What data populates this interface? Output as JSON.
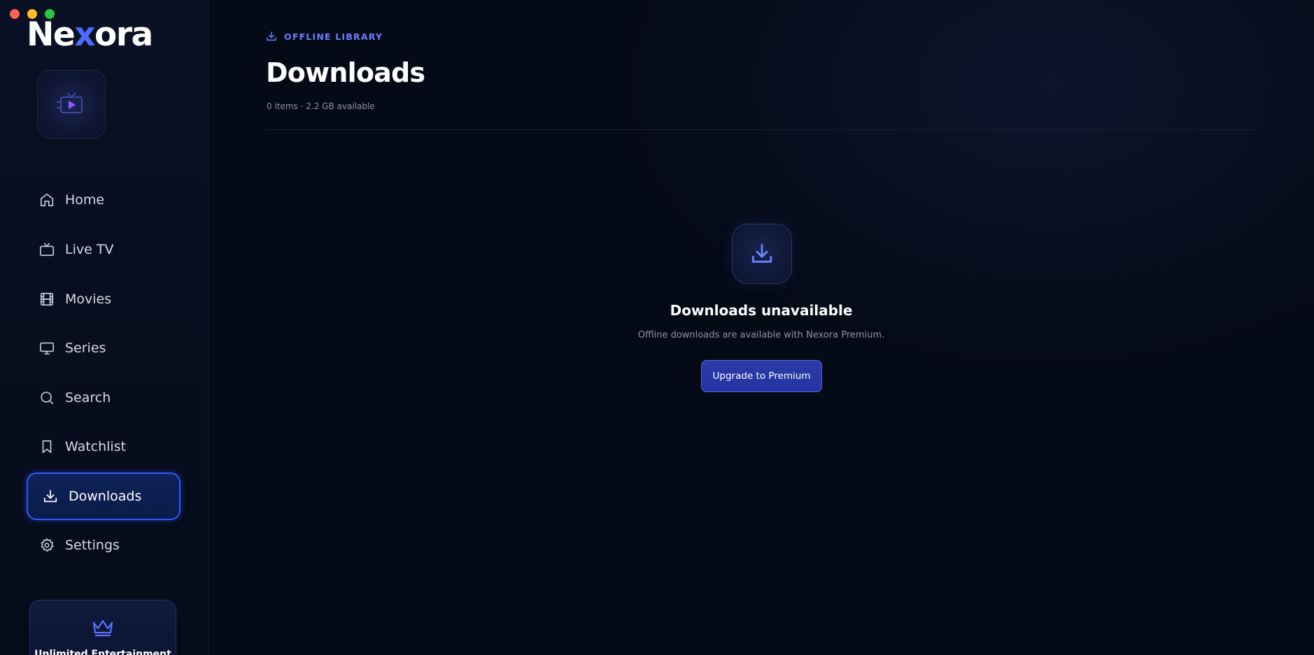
{
  "app": {
    "brand_prefix": "Ne",
    "brand_x": "x",
    "brand_suffix": "ora"
  },
  "colors": {
    "accent": "#2f59ff",
    "eyebrow": "#6b7fff",
    "background": "#050a17",
    "button": "#2b3aa8"
  },
  "sidebar": {
    "channel_tile_icon": "tv-play-icon",
    "items": [
      {
        "label": "Home",
        "icon": "home-icon",
        "active": false
      },
      {
        "label": "Live TV",
        "icon": "tv-icon",
        "active": false
      },
      {
        "label": "Movies",
        "icon": "film-icon",
        "active": false
      },
      {
        "label": "Series",
        "icon": "monitor-icon",
        "active": false
      },
      {
        "label": "Search",
        "icon": "search-icon",
        "active": false
      },
      {
        "label": "Watchlist",
        "icon": "bookmark-icon",
        "active": false
      },
      {
        "label": "Downloads",
        "icon": "download-icon",
        "active": true
      },
      {
        "label": "Settings",
        "icon": "gear-icon",
        "active": false
      }
    ],
    "premium_card": {
      "icon": "crown-icon",
      "title": "Unlimited Entertainment"
    }
  },
  "main": {
    "eyebrow": "OFFLINE LIBRARY",
    "title": "Downloads",
    "meta": "0 items · 2.2 GB available",
    "empty_state": {
      "icon": "download-icon",
      "title": "Downloads unavailable",
      "subtitle": "Offline downloads are available with Nexora Premium.",
      "button_label": "Upgrade to Premium"
    }
  }
}
